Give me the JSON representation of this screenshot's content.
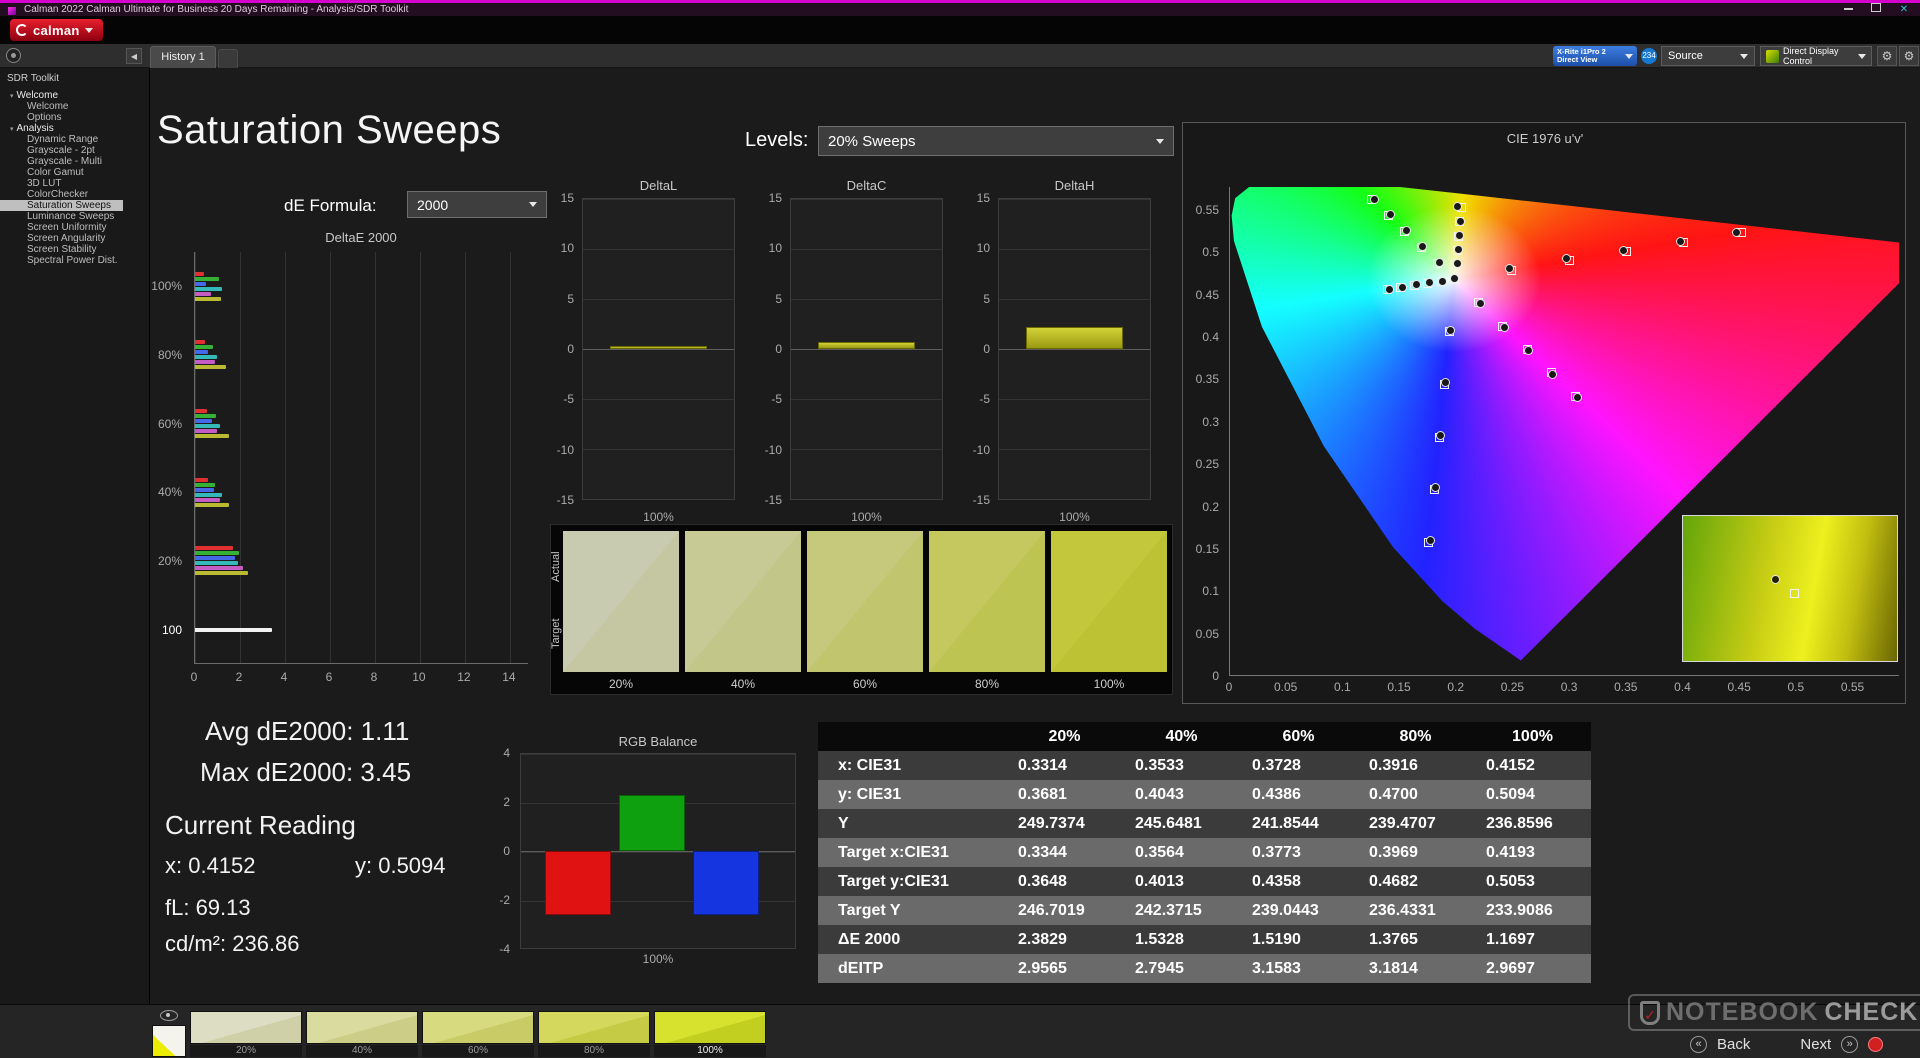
{
  "window": {
    "title": "Calman 2022 Calman Ultimate for Business 20 Days Remaining - Analysis/SDR Toolkit",
    "logo_text": "calman",
    "controls": {
      "close": "✕"
    }
  },
  "toolbar": {
    "history_tab": "History 1",
    "collapse_icon": "◀",
    "meter": {
      "line1": "X-Rite i1Pro 2",
      "line2": "Direct View"
    },
    "badge": "234",
    "source": "Source",
    "display_control": "Direct Display Control",
    "gear_icon": "⚙"
  },
  "sidebar": {
    "header": "SDR Toolkit",
    "tree": [
      {
        "label": "Welcome",
        "type": "group"
      },
      {
        "label": "Welcome",
        "type": "item"
      },
      {
        "label": "Options",
        "type": "item"
      },
      {
        "label": "Analysis",
        "type": "group"
      },
      {
        "label": "Dynamic Range",
        "type": "item"
      },
      {
        "label": "Grayscale - 2pt",
        "type": "item"
      },
      {
        "label": "Grayscale - Multi",
        "type": "item"
      },
      {
        "label": "Color Gamut",
        "type": "item"
      },
      {
        "label": "3D LUT",
        "type": "item"
      },
      {
        "label": "ColorChecker",
        "type": "item"
      },
      {
        "label": "Saturation Sweeps",
        "type": "item",
        "selected": true
      },
      {
        "label": "Luminance Sweeps",
        "type": "item"
      },
      {
        "label": "Screen Uniformity",
        "type": "item"
      },
      {
        "label": "Screen Angularity",
        "type": "item"
      },
      {
        "label": "Screen Stability",
        "type": "item"
      },
      {
        "label": "Spectral Power Dist.",
        "type": "item"
      }
    ]
  },
  "page": {
    "title": "Saturation Sweeps",
    "levels_label": "Levels:",
    "levels_value": "20% Sweeps",
    "formula_label": "dE Formula:",
    "formula_value": "2000"
  },
  "readings": {
    "avg": "Avg dE2000: 1.11",
    "max": "Max dE2000: 3.45",
    "current_title": "Current Reading",
    "x": "x: 0.4152",
    "y": "y: 0.5094",
    "fl": "fL: 69.13",
    "cd": "cd/m²: 236.86"
  },
  "chart_data": [
    {
      "id": "deltae2000",
      "type": "bar",
      "orientation": "horizontal",
      "title": "DeltaE 2000",
      "categories": [
        "100%",
        "80%",
        "60%",
        "40%",
        "20%",
        "100"
      ],
      "xlim": [
        0,
        14.85
      ],
      "xticks": [
        0,
        2,
        4,
        6,
        8,
        10,
        12,
        14
      ],
      "series": [
        {
          "name": "Red",
          "color": "#e03030",
          "values": [
            0.4,
            0.45,
            0.55,
            0.6,
            1.7,
            null
          ]
        },
        {
          "name": "Green",
          "color": "#35b135",
          "values": [
            1.05,
            0.8,
            0.95,
            0.9,
            1.95,
            null
          ]
        },
        {
          "name": "Blue",
          "color": "#4468e8",
          "values": [
            0.5,
            0.6,
            0.75,
            0.85,
            1.8,
            null
          ]
        },
        {
          "name": "Cyan",
          "color": "#35b8b8",
          "values": [
            1.2,
            1.0,
            1.1,
            1.2,
            1.9,
            null
          ]
        },
        {
          "name": "Magenta",
          "color": "#c45cc4",
          "values": [
            0.7,
            0.9,
            1.0,
            1.1,
            2.15,
            null
          ]
        },
        {
          "name": "Yellow",
          "color": "#b9b932",
          "values": [
            1.17,
            1.38,
            1.52,
            1.53,
            2.38,
            null
          ]
        },
        {
          "name": "White",
          "color": "#f2f2f2",
          "values": [
            null,
            null,
            null,
            null,
            null,
            3.45
          ]
        }
      ]
    },
    {
      "id": "deltaL",
      "type": "bar",
      "title": "DeltaL",
      "ylim": [
        -15,
        15
      ],
      "yticks": [
        15,
        10,
        5,
        0,
        -5,
        -10,
        -15
      ],
      "categories": [
        "100%"
      ],
      "values": [
        0.3
      ]
    },
    {
      "id": "deltaC",
      "type": "bar",
      "title": "DeltaC",
      "ylim": [
        -15,
        15
      ],
      "yticks": [
        15,
        10,
        5,
        0,
        -5,
        -10,
        -15
      ],
      "categories": [
        "100%"
      ],
      "values": [
        0.7
      ]
    },
    {
      "id": "deltaH",
      "type": "bar",
      "title": "DeltaH",
      "ylim": [
        -15,
        15
      ],
      "yticks": [
        15,
        10,
        5,
        0,
        -5,
        -10,
        -15
      ],
      "categories": [
        "100%"
      ],
      "values": [
        2.2
      ]
    },
    {
      "id": "rgb_balance",
      "type": "bar",
      "title": "RGB Balance",
      "ylim": [
        -4,
        4
      ],
      "yticks": [
        4,
        2,
        0,
        -2,
        -4
      ],
      "categories": [
        "100%"
      ],
      "series": [
        {
          "name": "Red",
          "color": "#e01212",
          "value": -2.6
        },
        {
          "name": "Green",
          "color": "#0fa00f",
          "value": 2.3
        },
        {
          "name": "Blue",
          "color": "#1535e0",
          "value": -2.6
        }
      ]
    },
    {
      "id": "cie",
      "type": "scatter",
      "title": "CIE 1976 u'v'",
      "xlim": [
        0,
        0.591
      ],
      "ylim": [
        0,
        0.577
      ],
      "xticks": [
        0,
        0.05,
        0.1,
        0.15,
        0.2,
        0.25,
        0.3,
        0.35,
        0.4,
        0.45,
        0.5,
        0.55
      ],
      "yticks": [
        0,
        0.05,
        0.1,
        0.15,
        0.2,
        0.25,
        0.3,
        0.35,
        0.4,
        0.45,
        0.5,
        0.55
      ],
      "white_point": [
        0.198,
        0.468
      ],
      "locus": [
        [
          0.2569,
          0.0172
        ],
        [
          0.2161,
          0.0549
        ],
        [
          0.1877,
          0.0871
        ],
        [
          0.1441,
          0.151
        ],
        [
          0.0828,
          0.2708
        ],
        [
          0.0282,
          0.4117
        ],
        [
          0.0035,
          0.5131
        ],
        [
          0.0014,
          0.5432
        ],
        [
          0.0046,
          0.5639
        ],
        [
          0.0231,
          0.5837
        ],
        [
          0.0501,
          0.5868
        ],
        [
          0.0792,
          0.5856
        ],
        [
          0.1127,
          0.5821
        ],
        [
          0.1531,
          0.5766
        ],
        [
          0.2026,
          0.5693
        ],
        [
          0.2623,
          0.5604
        ],
        [
          0.3316,
          0.5501
        ],
        [
          0.4035,
          0.5393
        ],
        [
          0.4692,
          0.5296
        ],
        [
          0.5202,
          0.5219
        ],
        [
          0.583,
          0.5125
        ],
        [
          0.6234,
          0.5065
        ]
      ],
      "targets": [
        [
          0.198,
          0.468
        ],
        [
          0.2486,
          0.479
        ],
        [
          0.2992,
          0.49
        ],
        [
          0.3498,
          0.501
        ],
        [
          0.4004,
          0.512
        ],
        [
          0.451,
          0.523
        ],
        [
          0.1834,
          0.4869
        ],
        [
          0.1688,
          0.5058
        ],
        [
          0.1542,
          0.5247
        ],
        [
          0.1396,
          0.5436
        ],
        [
          0.125,
          0.5625
        ],
        [
          0.1935,
          0.406
        ],
        [
          0.189,
          0.344
        ],
        [
          0.1845,
          0.282
        ],
        [
          0.18,
          0.22
        ],
        [
          0.1754,
          0.158
        ],
        [
          0.1862,
          0.4656
        ],
        [
          0.1744,
          0.4632
        ],
        [
          0.1626,
          0.4608
        ],
        [
          0.1508,
          0.4584
        ],
        [
          0.139,
          0.456
        ],
        [
          0.2194,
          0.4404
        ],
        [
          0.2408,
          0.4128
        ],
        [
          0.2622,
          0.3852
        ],
        [
          0.2836,
          0.3576
        ],
        [
          0.305,
          0.33
        ],
        [
          0.1992,
          0.485
        ],
        [
          0.2004,
          0.502
        ],
        [
          0.2016,
          0.519
        ],
        [
          0.2028,
          0.536
        ],
        [
          0.204,
          0.553
        ]
      ],
      "measured": [
        [
          0.1984,
          0.4689
        ],
        [
          0.2462,
          0.4804
        ],
        [
          0.2965,
          0.4921
        ],
        [
          0.3471,
          0.5024
        ],
        [
          0.3978,
          0.5131
        ],
        [
          0.4465,
          0.5238
        ],
        [
          0.1851,
          0.488
        ],
        [
          0.1702,
          0.5066
        ],
        [
          0.156,
          0.5255
        ],
        [
          0.1412,
          0.544
        ],
        [
          0.1272,
          0.5619
        ],
        [
          0.1948,
          0.4081
        ],
        [
          0.1903,
          0.3462
        ],
        [
          0.1859,
          0.2838
        ],
        [
          0.1812,
          0.2225
        ],
        [
          0.1769,
          0.1604
        ],
        [
          0.1875,
          0.466
        ],
        [
          0.1758,
          0.4638
        ],
        [
          0.1641,
          0.4615
        ],
        [
          0.1522,
          0.459
        ],
        [
          0.1405,
          0.4566
        ],
        [
          0.2208,
          0.4392
        ],
        [
          0.2421,
          0.411
        ],
        [
          0.2633,
          0.3835
        ],
        [
          0.2849,
          0.3562
        ],
        [
          0.3061,
          0.3285
        ],
        [
          0.2003,
          0.4862
        ],
        [
          0.2012,
          0.503
        ],
        [
          0.2021,
          0.5198
        ],
        [
          0.203,
          0.5366
        ],
        [
          0.2005,
          0.5535
        ]
      ],
      "inset": {
        "measured_pct": [
          41,
          41
        ],
        "target_pct": [
          50,
          50
        ]
      }
    }
  ],
  "swatch_panel": {
    "row_labels": [
      "Actual",
      "Target"
    ],
    "swatches": [
      {
        "label": "20%",
        "actual": "#c9cbb1",
        "target": "#c4c7a2"
      },
      {
        "label": "40%",
        "actual": "#c8ca96",
        "target": "#c2c689"
      },
      {
        "label": "60%",
        "actual": "#c6c97c",
        "target": "#c0c56e"
      },
      {
        "label": "80%",
        "actual": "#c4c85e",
        "target": "#bec452"
      },
      {
        "label": "100%",
        "actual": "#c2c73c",
        "target": "#bcc233"
      }
    ]
  },
  "table": {
    "columns": [
      "",
      "20%",
      "40%",
      "60%",
      "80%",
      "100%"
    ],
    "rows": [
      {
        "label": "x: CIE31",
        "values": [
          "0.3314",
          "0.3533",
          "0.3728",
          "0.3916",
          "0.4152"
        ]
      },
      {
        "label": "y: CIE31",
        "values": [
          "0.3681",
          "0.4043",
          "0.4386",
          "0.4700",
          "0.5094"
        ]
      },
      {
        "label": "Y",
        "values": [
          "249.7374",
          "245.6481",
          "241.8544",
          "239.4707",
          "236.8596"
        ]
      },
      {
        "label": "Target x:CIE31",
        "values": [
          "0.3344",
          "0.3564",
          "0.3773",
          "0.3969",
          "0.4193"
        ]
      },
      {
        "label": "Target y:CIE31",
        "values": [
          "0.3648",
          "0.4013",
          "0.4358",
          "0.4682",
          "0.5053"
        ]
      },
      {
        "label": "Target Y",
        "values": [
          "246.7019",
          "242.3715",
          "239.0443",
          "236.4331",
          "233.9086"
        ]
      },
      {
        "label": "ΔE 2000",
        "values": [
          "2.3829",
          "1.5328",
          "1.5190",
          "1.3765",
          "1.1697"
        ]
      },
      {
        "label": "dEITP",
        "values": [
          "2.9565",
          "2.7945",
          "3.1583",
          "3.1814",
          "2.9697"
        ]
      }
    ]
  },
  "bottom": {
    "white_patch": {
      "main": "#f4f4ec",
      "corner": "#ecec00"
    },
    "patches": [
      {
        "label": "20%",
        "color": "#dcddc2",
        "color2": "#cfd0a8"
      },
      {
        "label": "40%",
        "color": "#dadc9f",
        "color2": "#ccce87"
      },
      {
        "label": "60%",
        "color": "#d7da7f",
        "color2": "#c9cc66"
      },
      {
        "label": "80%",
        "color": "#d4d95e",
        "color2": "#c6cb45",
        "selected": false
      },
      {
        "label": "100%",
        "color": "#d6e22e",
        "color2": "#c3cf20",
        "selected": true
      }
    ]
  },
  "watermark": {
    "check": "✓",
    "part1": "NOTEBOOK",
    "part2": "CHECK",
    "back_icon": "«",
    "back": "Back",
    "next": "Next",
    "next_icon": "»"
  }
}
